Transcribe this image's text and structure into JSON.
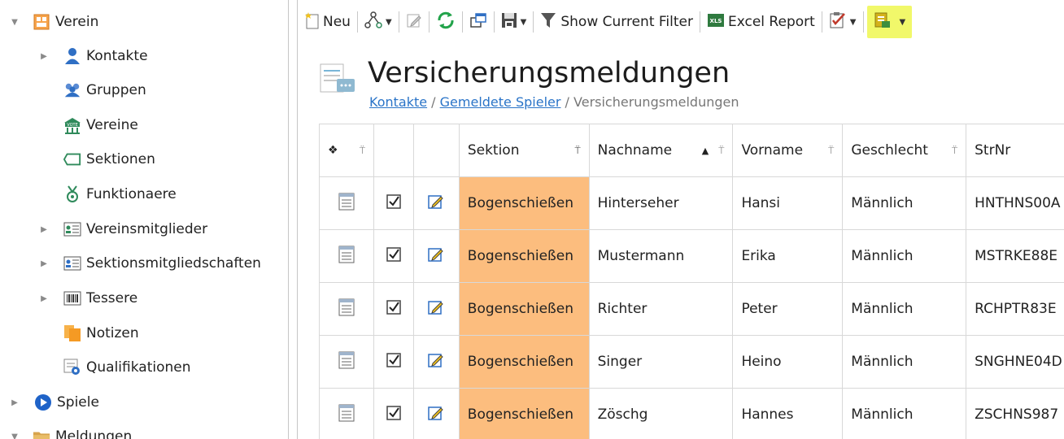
{
  "sidebar": {
    "items": [
      {
        "label": "Verein",
        "icon": "verein-icon",
        "arrow": "expanded"
      },
      {
        "label": "Kontakte",
        "icon": "person-icon",
        "arrow": "collapsed"
      },
      {
        "label": "Gruppen",
        "icon": "group-icon",
        "arrow": ""
      },
      {
        "label": "Vereine",
        "icon": "vote-icon",
        "arrow": ""
      },
      {
        "label": "Sektionen",
        "icon": "tag-icon",
        "arrow": ""
      },
      {
        "label": "Funktionaere",
        "icon": "medal-icon",
        "arrow": ""
      },
      {
        "label": "Vereinsmitglieder",
        "icon": "id-card-icon",
        "arrow": "collapsed"
      },
      {
        "label": "Sektionsmitgliedschaften",
        "icon": "id-card-icon",
        "arrow": "collapsed"
      },
      {
        "label": "Tessere",
        "icon": "barcode-icon",
        "arrow": "collapsed"
      },
      {
        "label": "Notizen",
        "icon": "notes-icon",
        "arrow": ""
      },
      {
        "label": "Qualifikationen",
        "icon": "qualification-icon",
        "arrow": ""
      },
      {
        "label": "Spiele",
        "icon": "play-icon",
        "arrow": "collapsed"
      },
      {
        "label": "Meldungen",
        "icon": "folder-icon",
        "arrow": "expanded"
      }
    ]
  },
  "toolbar": {
    "new_label": "Neu",
    "filter_label": "Show Current Filter",
    "excel_label": "Excel Report",
    "highlight_color": "#f1f86a"
  },
  "header": {
    "title": "Versicherungsmeldungen",
    "breadcrumb": {
      "link1": "Kontakte",
      "sep1": " / ",
      "link2": "Gemeldete Spieler",
      "sep2": " / ",
      "current": "Versicherungsmeldungen"
    }
  },
  "grid": {
    "header_first": "❖",
    "columns": [
      "Sektion",
      "Nachname",
      "Vorname",
      "Geschlecht",
      "StrNr"
    ],
    "sort_indicator": "▲",
    "sektion_color": "#fcbd7e",
    "rows": [
      {
        "sektion": "Bogenschießen",
        "nachname": "Hinterseher",
        "vorname": "Hansi",
        "geschlecht": "Männlich",
        "strnr": "HNTHNS00A"
      },
      {
        "sektion": "Bogenschießen",
        "nachname": "Mustermann",
        "vorname": "Erika",
        "geschlecht": "Männlich",
        "strnr": "MSTRKE88E"
      },
      {
        "sektion": "Bogenschießen",
        "nachname": "Richter",
        "vorname": "Peter",
        "geschlecht": "Männlich",
        "strnr": "RCHPTR83E"
      },
      {
        "sektion": "Bogenschießen",
        "nachname": "Singer",
        "vorname": "Heino",
        "geschlecht": "Männlich",
        "strnr": "SNGHNE04D"
      },
      {
        "sektion": "Bogenschießen",
        "nachname": "Zöschg",
        "vorname": "Hannes",
        "geschlecht": "Männlich",
        "strnr": "ZSCHNS987"
      }
    ]
  }
}
